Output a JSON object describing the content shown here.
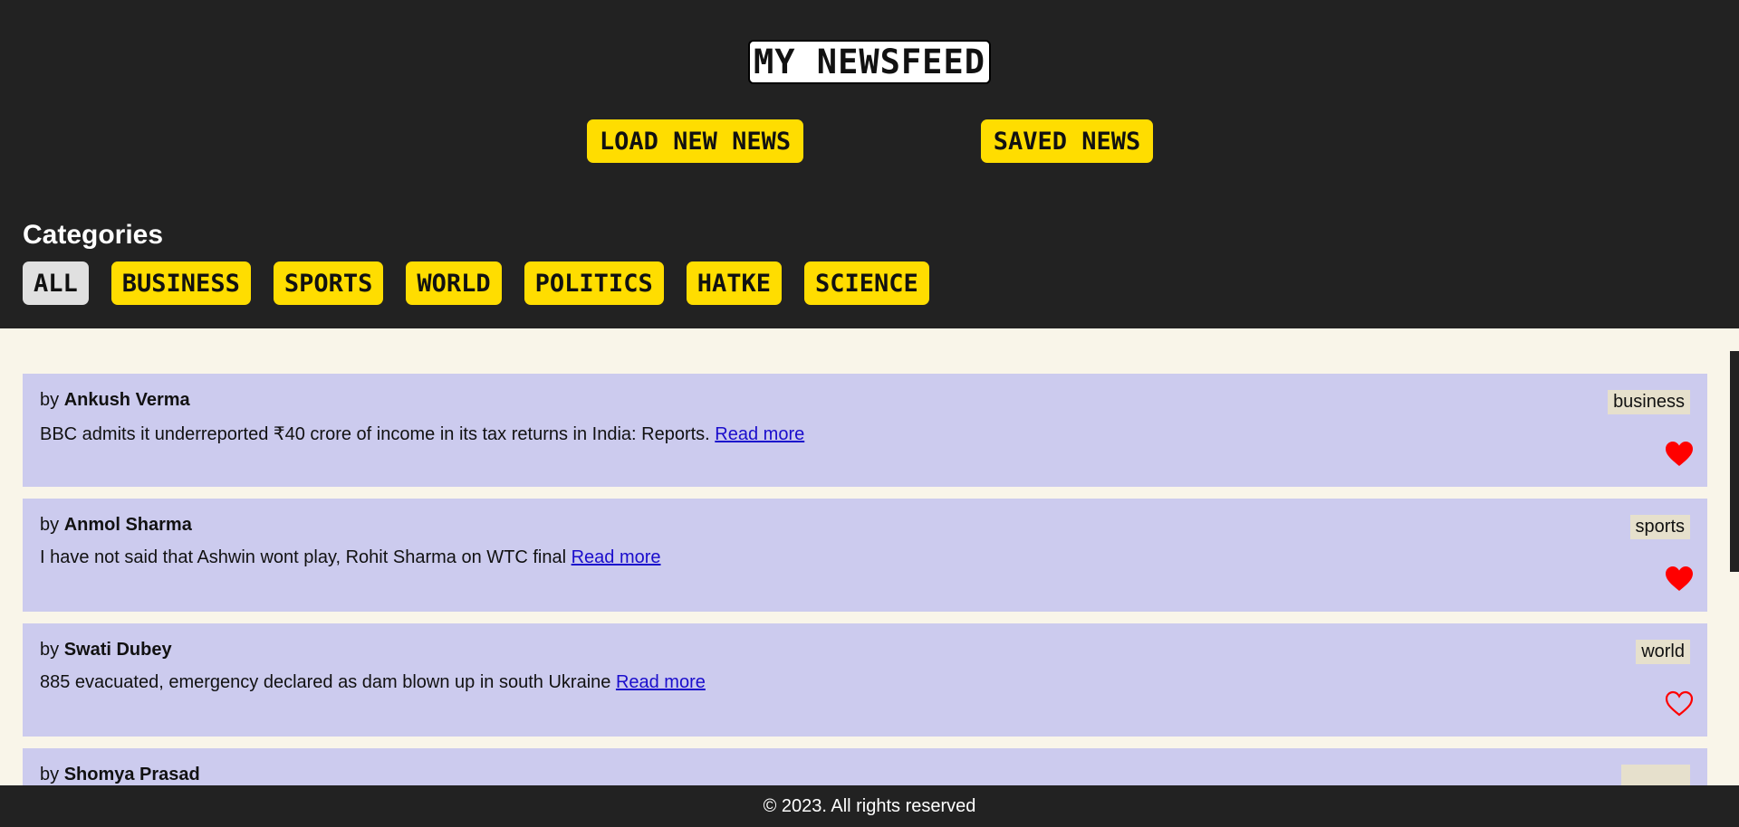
{
  "header": {
    "title": "MY NEWSFEED",
    "load_button": "LOAD NEW NEWS",
    "saved_button": "SAVED NEWS"
  },
  "categories": {
    "heading": "Categories",
    "items": [
      "ALL",
      "BUSINESS",
      "SPORTS",
      "WORLD",
      "POLITICS",
      "HATKE",
      "SCIENCE"
    ],
    "active": "ALL"
  },
  "feed": [
    {
      "by": "by ",
      "author": "Ankush Verma",
      "headline": "BBC admits it underreported ₹40 crore of income in its tax returns in India: Reports. ",
      "link": "Read more",
      "category": "business",
      "saved": true
    },
    {
      "by": "by ",
      "author": "Anmol Sharma",
      "headline": "I have not said that Ashwin wont play, Rohit Sharma on WTC final ",
      "link": "Read more",
      "category": "sports",
      "saved": true
    },
    {
      "by": "by ",
      "author": "Swati Dubey",
      "headline": "885 evacuated, emergency declared as dam blown up in south Ukraine ",
      "link": "Read more",
      "category": "world",
      "saved": false
    },
    {
      "by": "by ",
      "author": "Shomya Prasad",
      "headline": "",
      "link": "",
      "category": "",
      "saved": false
    }
  ],
  "footer": {
    "text": "© 2023. All rights reserved"
  },
  "colors": {
    "header_bg": "#222222",
    "accent": "#ffdd00",
    "card_bg": "#cccbee",
    "page_bg": "#f9f5e9",
    "heart": "#ff0000"
  },
  "icons": {
    "save_filled": "heart-filled-icon",
    "save_outline": "heart-outline-icon"
  }
}
